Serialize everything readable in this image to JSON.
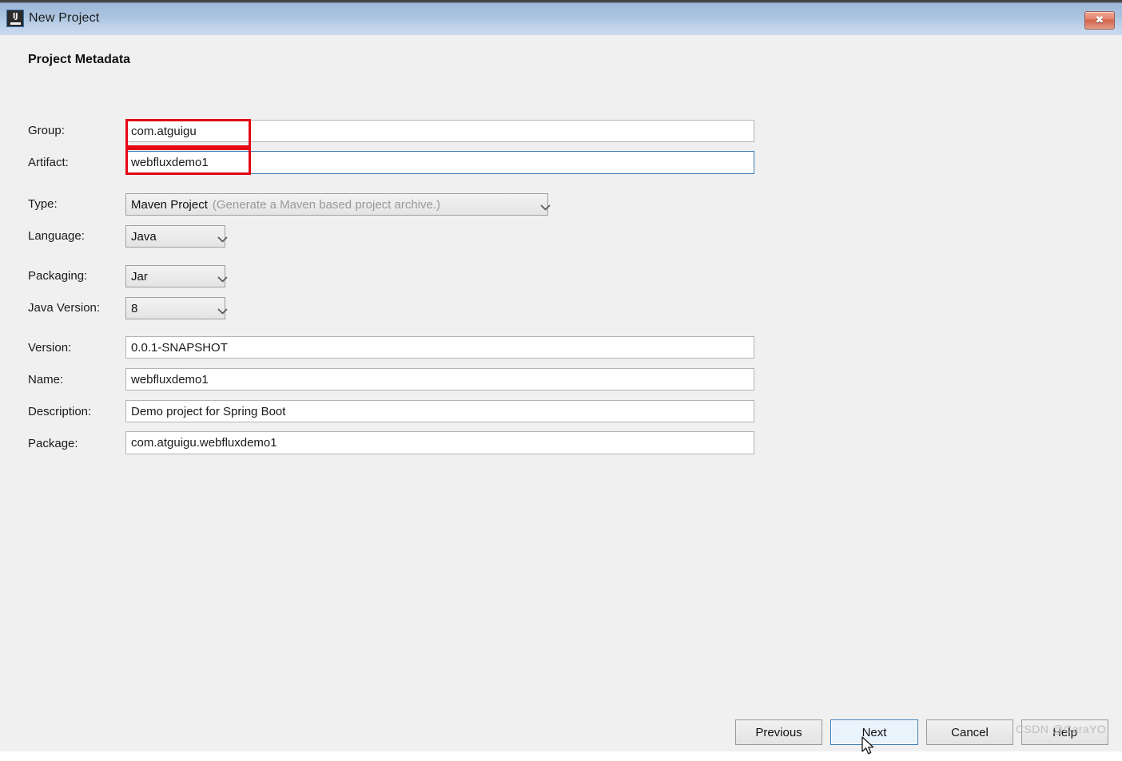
{
  "window": {
    "title": "New Project",
    "icon_name": "intellij-idea-icon",
    "icon_letters": "IJ",
    "close_label": "✖"
  },
  "section": {
    "title": "Project Metadata"
  },
  "fields": {
    "group": {
      "label": "Group:",
      "value": "com.atguigu"
    },
    "artifact": {
      "label": "Artifact:",
      "value": "webfluxdemo1"
    },
    "version": {
      "label": "Version:",
      "value": "0.0.1-SNAPSHOT"
    },
    "name": {
      "label": "Name:",
      "value": "webfluxdemo1"
    },
    "description": {
      "label": "Description:",
      "value": "Demo project for Spring Boot"
    },
    "package": {
      "label": "Package:",
      "value": "com.atguigu.webfluxdemo1"
    }
  },
  "dropdowns": {
    "type": {
      "label": "Type:",
      "value": "Maven Project",
      "hint": "(Generate a Maven based project archive.)"
    },
    "language": {
      "label": "Language:",
      "value": "Java"
    },
    "packaging": {
      "label": "Packaging:",
      "value": "Jar"
    },
    "java_version": {
      "label": "Java Version:",
      "value": "8"
    }
  },
  "buttons": {
    "previous": "Previous",
    "next": "Next",
    "cancel": "Cancel",
    "help": "Help"
  },
  "watermark": {
    "text": "CSDN @CaraYO"
  },
  "colors": {
    "titlebar_top": "#9db9d8",
    "titlebar_bottom": "#ccdaf0",
    "content_bg": "#f0f0f0",
    "focus_blue": "#3a7bb5",
    "annotation_red": "#e30613",
    "default_button_bg": "#e9f3fc"
  }
}
